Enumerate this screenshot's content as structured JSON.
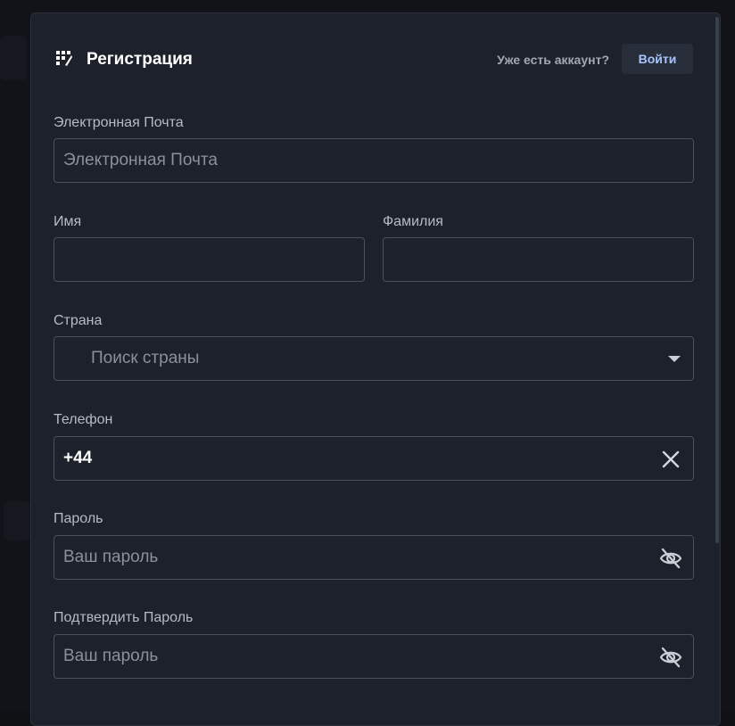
{
  "header": {
    "title": "Регистрация",
    "have_account": "Уже есть аккаунт?",
    "login_label": "Войти"
  },
  "form": {
    "email": {
      "label": "Электронная Почта",
      "placeholder": "Электронная Почта",
      "value": ""
    },
    "first_name": {
      "label": "Имя",
      "value": ""
    },
    "last_name": {
      "label": "Фамилия",
      "value": ""
    },
    "country": {
      "label": "Страна",
      "placeholder": "Поиск страны",
      "icon": "chevron-down-icon"
    },
    "phone": {
      "label": "Телефон",
      "value": "+44",
      "icon": "close-icon"
    },
    "password": {
      "label": "Пароль",
      "placeholder": "Ваш пароль",
      "icon": "eye-off-icon"
    },
    "confirm_password": {
      "label": "Подтвердить Пароль",
      "placeholder": "Ваш пароль",
      "icon": "eye-off-icon"
    }
  },
  "colors": {
    "modal_bg": "#1c212b",
    "input_border": "#4a505b",
    "label": "#b6bbc4",
    "login_text": "#a9c3ff"
  }
}
